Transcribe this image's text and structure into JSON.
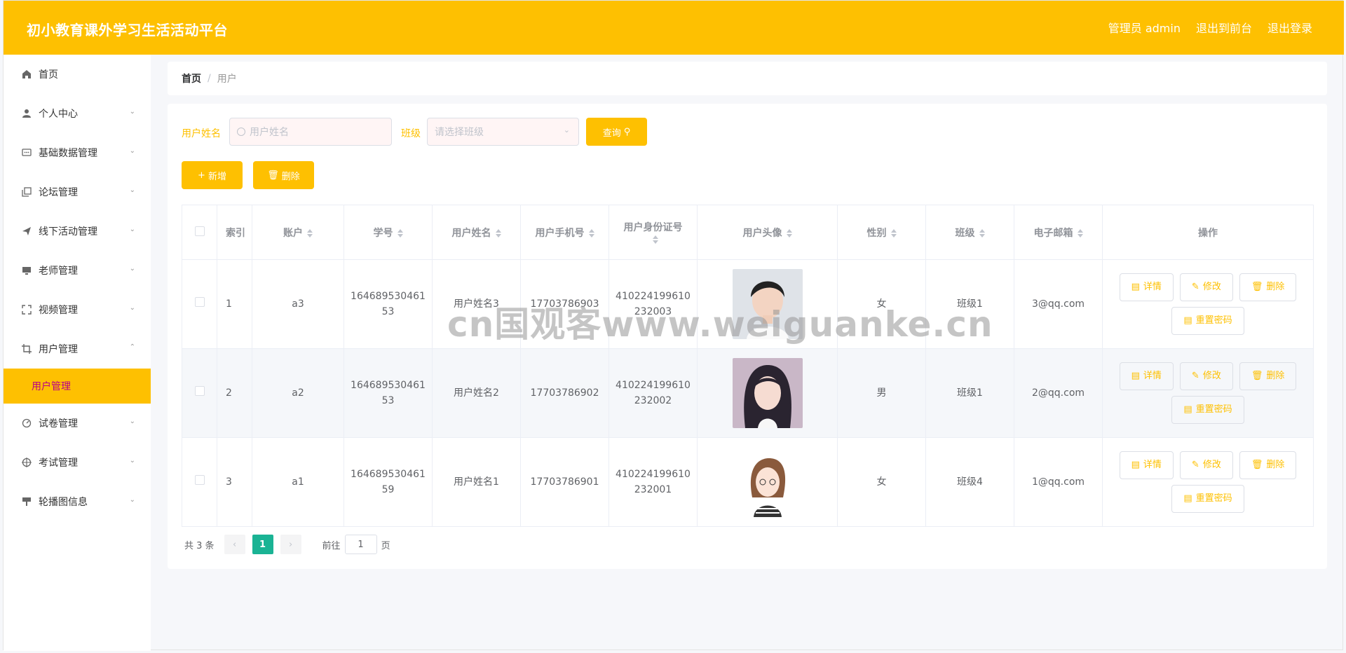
{
  "app": {
    "title": "初小教育课外学习生活活动平台"
  },
  "header": {
    "admin": "管理员 admin",
    "front": "退出到前台",
    "logout": "退出登录"
  },
  "sidebar": {
    "items": [
      {
        "label": "首页",
        "icon": "home-icon"
      },
      {
        "label": "个人中心",
        "icon": "user-icon"
      },
      {
        "label": "基础数据管理",
        "icon": "chat-icon"
      },
      {
        "label": "论坛管理",
        "icon": "copy-icon"
      },
      {
        "label": "线下活动管理",
        "icon": "send-icon"
      },
      {
        "label": "老师管理",
        "icon": "monitor-icon"
      },
      {
        "label": "视频管理",
        "icon": "fullscreen-icon"
      },
      {
        "label": "用户管理",
        "icon": "crop-icon"
      },
      {
        "label": "试卷管理",
        "icon": "gauge-icon"
      },
      {
        "label": "考试管理",
        "icon": "target-icon"
      },
      {
        "label": "轮播图信息",
        "icon": "stand-icon"
      }
    ],
    "sub_active": "用户管理"
  },
  "breadcrumb": {
    "home": "首页",
    "sep": "/",
    "current": "用户"
  },
  "search": {
    "name_label": "用户姓名",
    "name_placeholder": "用户姓名",
    "class_label": "班级",
    "class_placeholder": "请选择班级",
    "query": "查询"
  },
  "actions": {
    "add": "新增",
    "delete": "删除"
  },
  "table": {
    "headers": [
      "索引",
      "账户",
      "学号",
      "用户姓名",
      "用户手机号",
      "用户身份证号",
      "用户头像",
      "性别",
      "班级",
      "电子邮箱",
      "操作"
    ],
    "rows": [
      {
        "index": "1",
        "account": "a3",
        "sid": "164689530461 53",
        "name": "用户姓名3",
        "phone": "17703786903",
        "idcard": "410224199610 232003",
        "gender": "女",
        "cls": "班级1",
        "email": "3@qq.com"
      },
      {
        "index": "2",
        "account": "a2",
        "sid": "164689530461 53",
        "name": "用户姓名2",
        "phone": "17703786902",
        "idcard": "410224199610 232002",
        "gender": "男",
        "cls": "班级1",
        "email": "2@qq.com"
      },
      {
        "index": "3",
        "account": "a1",
        "sid": "164689530461 59",
        "name": "用户姓名1",
        "phone": "17703786901",
        "idcard": "410224199610 232001",
        "gender": "女",
        "cls": "班级4",
        "email": "1@qq.com"
      }
    ],
    "op": {
      "detail": "详情",
      "edit": "修改",
      "del": "删除",
      "reset": "重置密码"
    }
  },
  "pager": {
    "total": "共 3 条",
    "page": "1",
    "goto": "前往",
    "goto_value": "1",
    "unit": "页"
  },
  "watermark": "cn国观客www.weiguanke.cn",
  "colors": {
    "accent": "#fec001",
    "active_page": "#1ab394",
    "sub_menu_text": "#b8008a"
  }
}
